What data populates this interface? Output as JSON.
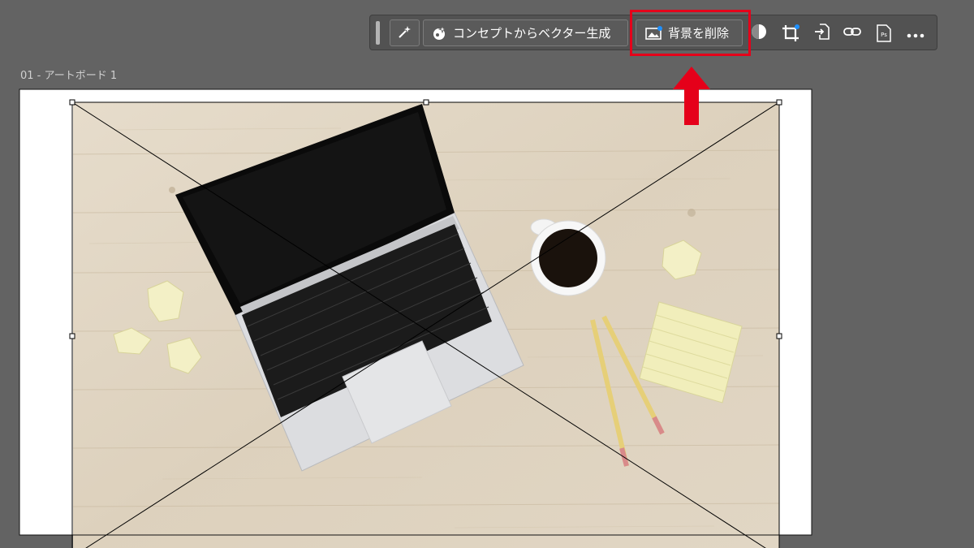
{
  "taskbar": {
    "generate_concept_label": "コンセプトからベクター生成",
    "remove_background_label": "背景を削除",
    "photoshop_icon_text": "Ps"
  },
  "artboard": {
    "label": "01 - アートボード 1"
  },
  "icons": [
    "magic-wand-icon",
    "sparkle-bulb-icon",
    "image-icon",
    "mask-icon",
    "crop-icon",
    "embed-icon",
    "link-icon",
    "photoshop-icon",
    "more-icon"
  ],
  "colors": {
    "highlight": "#e5001a",
    "canvas_bg": "#636363",
    "taskbar_bg": "#525252",
    "accent_dot": "#1e90ff"
  }
}
